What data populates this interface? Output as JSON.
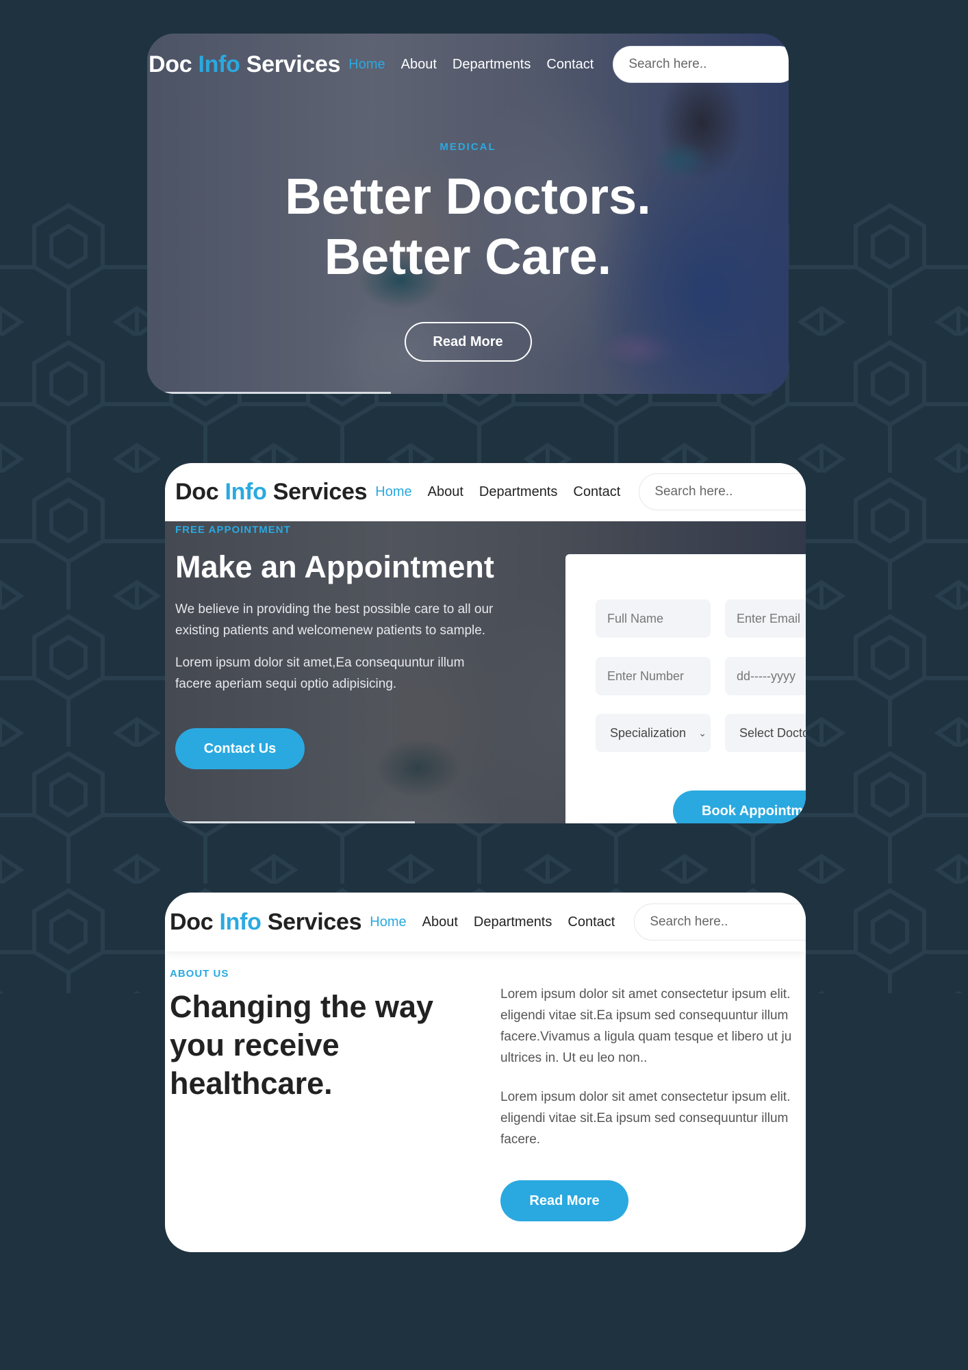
{
  "brand": {
    "part1": "Doc ",
    "accent": "Info",
    "part2": " Services"
  },
  "nav": {
    "home": "Home",
    "about": "About",
    "departments": "Departments",
    "contact": "Contact"
  },
  "search": {
    "placeholder": "Search here.."
  },
  "colors": {
    "accent": "#2aa9e0",
    "page_bg": "#1f3240"
  },
  "hero": {
    "eyebrow": "MEDICAL",
    "title_line1": "Better Doctors.",
    "title_line2": "Better Care.",
    "button": "Read More",
    "slider_progress": 0.38
  },
  "appointment": {
    "eyebrow": "FREE APPOINTMENT",
    "title": "Make an Appointment",
    "para1_line1": "We believe in providing the best possible care to all our",
    "para1_line2": "existing patients and welcomenew patients to sample.",
    "para2_line1": "Lorem ipsum dolor sit amet,Ea consequuntur illum",
    "para2_line2": "facere aperiam sequi optio adipisicing.",
    "contact_button": "Contact Us",
    "form": {
      "full_name_placeholder": "Full Name",
      "email_placeholder": "Enter Email",
      "number_placeholder": "Enter Number",
      "date_placeholder": "dd-----yyyy",
      "specialization": "Specialization",
      "doctor": "Select Doctor",
      "submit": "Book Appointment"
    },
    "slider_progress": 0.39
  },
  "about": {
    "eyebrow": "ABOUT US",
    "title_line1": "Changing the way",
    "title_line2": "you receive",
    "title_line3": "healthcare.",
    "p1_lines": [
      "Lorem ipsum dolor sit amet consectetur ipsum elit.",
      "eligendi vitae sit.Ea ipsum sed consequuntur illum",
      "facere.Vivamus a ligula quam tesque et libero ut ju",
      "ultrices in. Ut eu leo non.."
    ],
    "p2_lines": [
      "Lorem ipsum dolor sit amet consectetur ipsum elit.",
      "eligendi vitae sit.Ea ipsum sed consequuntur illum",
      "facere."
    ],
    "button": "Read More"
  }
}
